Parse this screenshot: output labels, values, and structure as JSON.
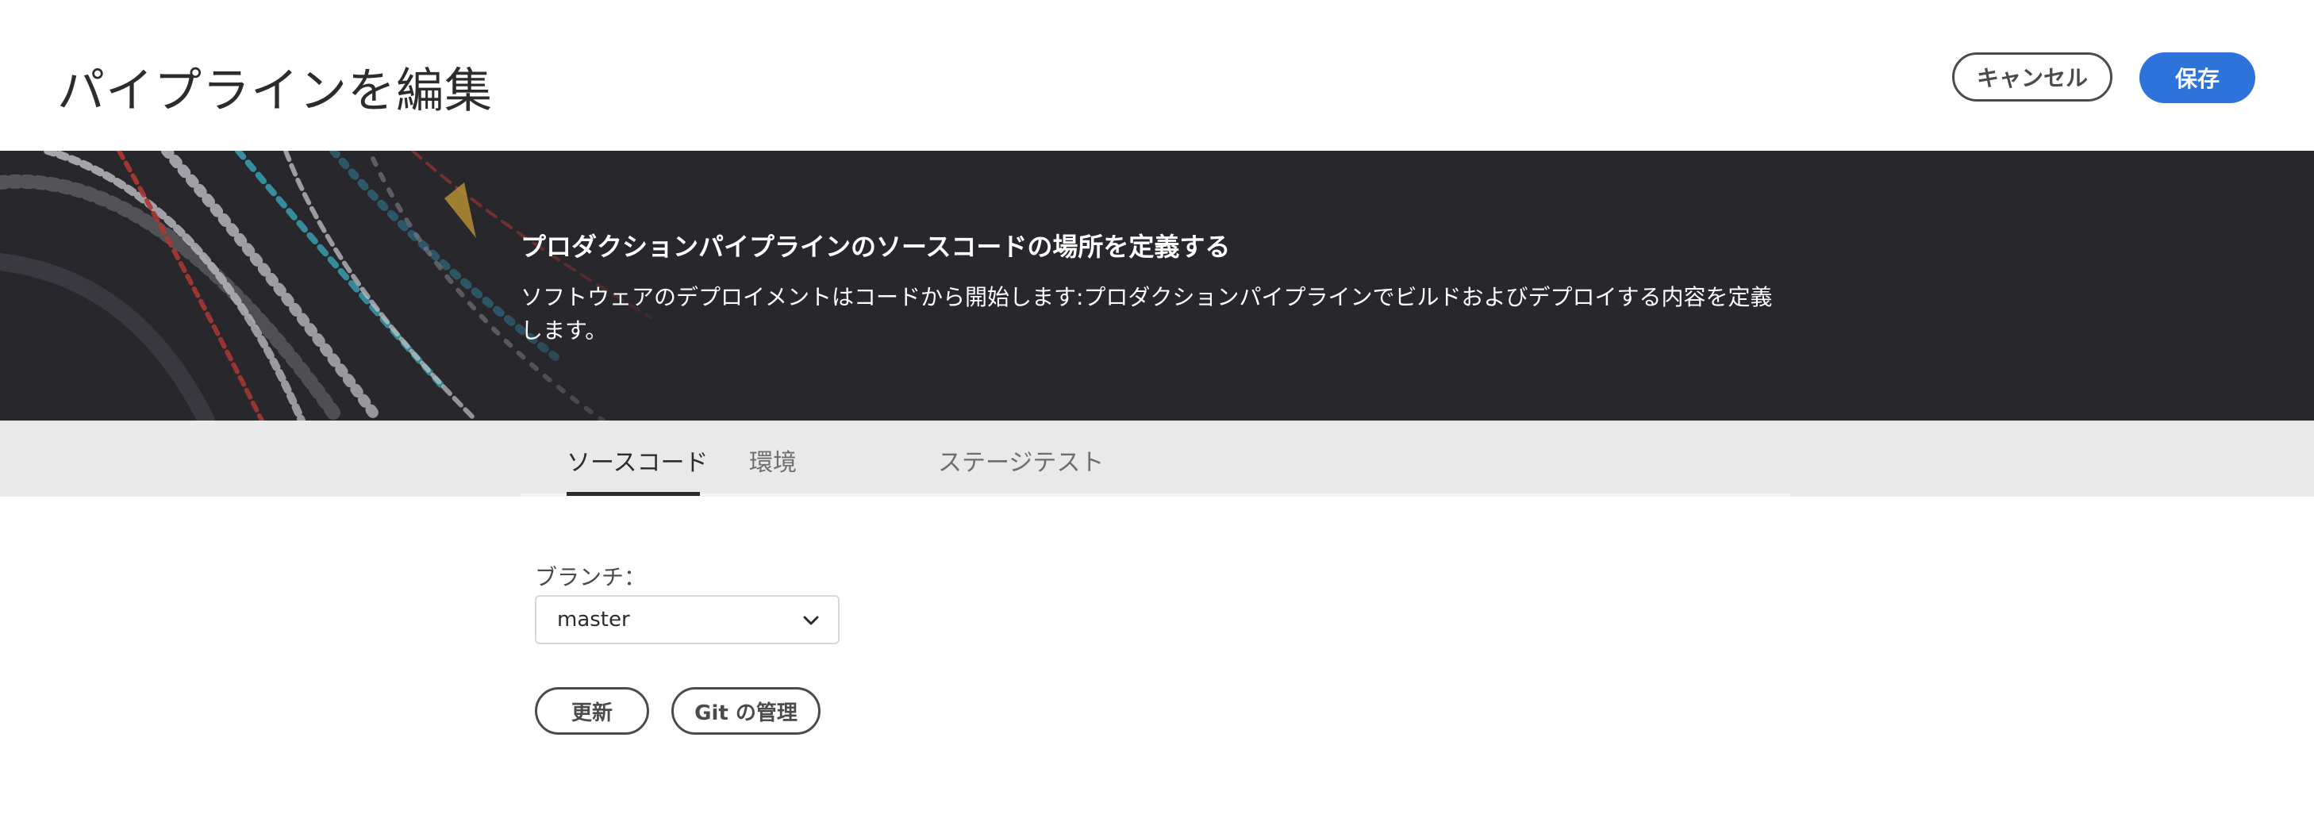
{
  "header": {
    "title": "パイプラインを編集",
    "cancel_label": "キャンセル",
    "save_label": "保存"
  },
  "hero": {
    "title": "プロダクションパイプラインのソースコードの場所を定義する",
    "description": "ソフトウェアのデプロイメントはコードから開始します:プロダクションパイプラインでビルドおよびデプロイする内容を定義します。"
  },
  "tabs": [
    {
      "label": "ソースコード",
      "active": true
    },
    {
      "label": "環境",
      "active": false
    },
    {
      "label": "ステージテスト",
      "active": false
    }
  ],
  "form": {
    "branch_label": "ブランチ：",
    "branch_value": "master",
    "refresh_label": "更新",
    "git_label": "Git の管理"
  },
  "colors": {
    "accent": "#2d73d9",
    "hero_bg": "#28272c",
    "tab_bg": "#e9e9e9"
  }
}
